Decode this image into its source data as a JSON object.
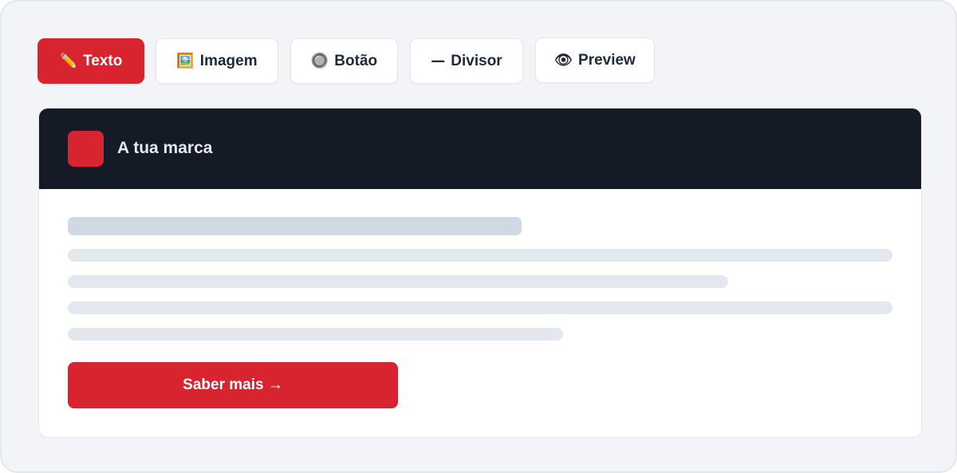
{
  "toolbar": {
    "items": [
      {
        "icon": "pencil-icon",
        "glyph": "✏️",
        "label": "Texto",
        "active": true
      },
      {
        "icon": "picture-icon",
        "glyph": "🖼️",
        "label": "Imagem",
        "active": false
      },
      {
        "icon": "radio-button-icon",
        "glyph": "🔘",
        "label": "Botão",
        "active": false
      },
      {
        "icon": "dash-icon",
        "glyph": "—",
        "label": "Divisor",
        "active": false
      },
      {
        "icon": "eye-icon",
        "glyph": "👁",
        "label": "Preview",
        "active": false
      }
    ]
  },
  "email": {
    "brand_name": "A tua marca",
    "cta_label": "Saber mais →"
  },
  "colors": {
    "accent": "#d7242e",
    "header_bg": "#141b26",
    "canvas_bg": "#f2f4f7"
  }
}
